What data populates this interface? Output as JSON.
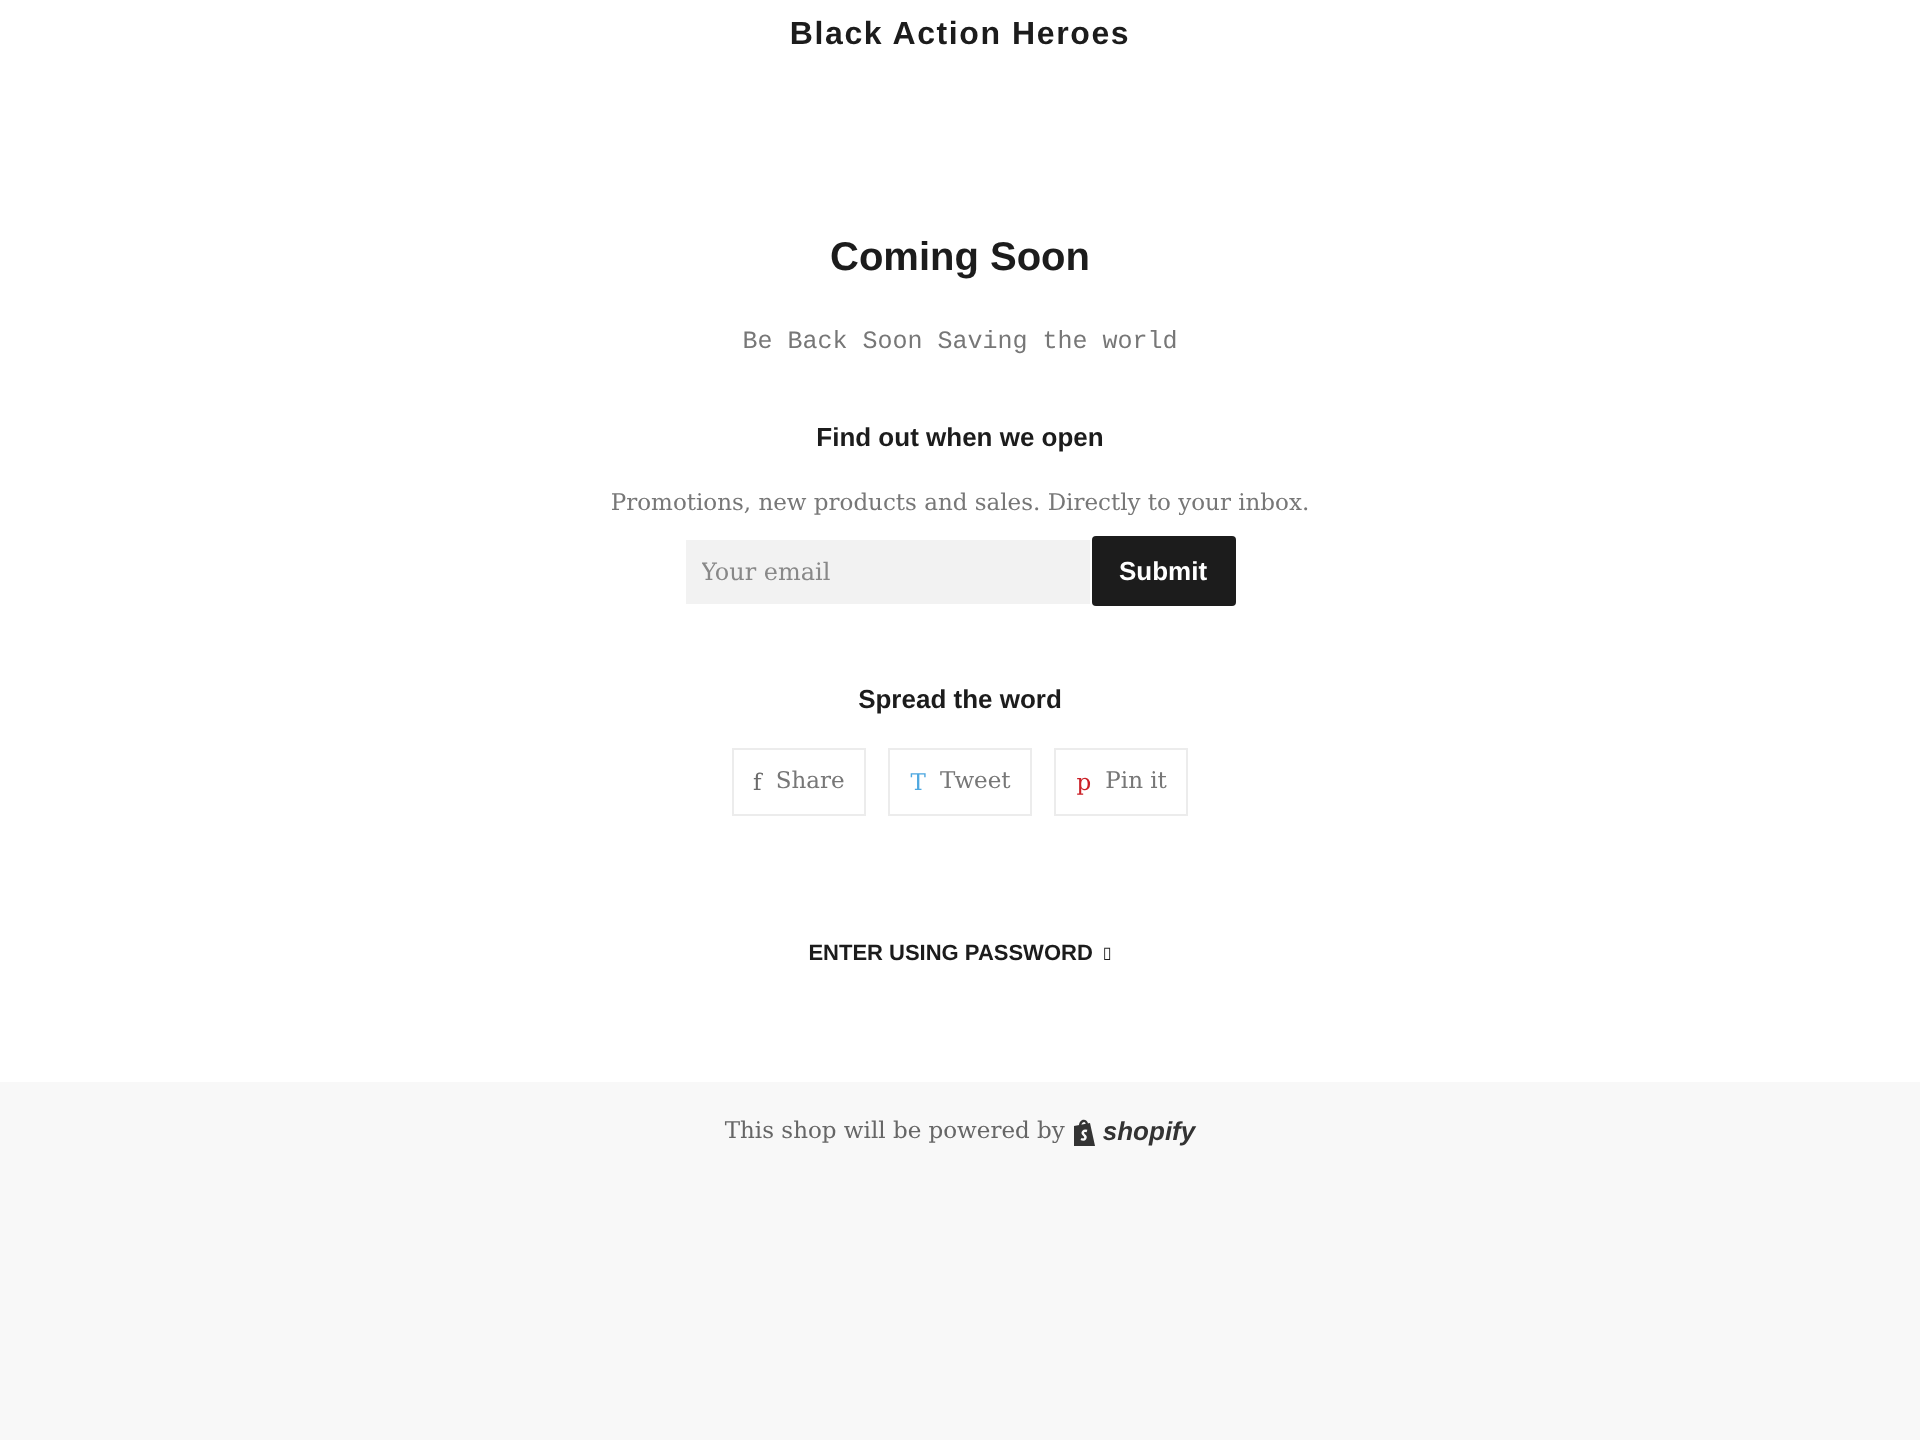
{
  "header": {
    "title": "Black Action Heroes"
  },
  "hero": {
    "heading": "Coming Soon",
    "message": "Be Back Soon Saving the world"
  },
  "newsletter": {
    "heading": "Find out when we open",
    "text": "Promotions, new products and sales. Directly to your inbox.",
    "email_field": {
      "placeholder": "Your email"
    },
    "submit_button": "Submit"
  },
  "share": {
    "heading": "Spread the word",
    "buttons": [
      {
        "icon": "f",
        "label": "Share",
        "color": "#6b6b6b"
      },
      {
        "icon": "T",
        "label": "Tweet",
        "color": "#4fa8e0"
      },
      {
        "icon": "p",
        "label": "Pin it",
        "color": "#cb2027"
      }
    ]
  },
  "password_link": {
    "label": "ENTER USING PASSWORD",
    "icon": "▯"
  },
  "footer": {
    "text": "This shop will be powered by",
    "logo": "shopify"
  }
}
